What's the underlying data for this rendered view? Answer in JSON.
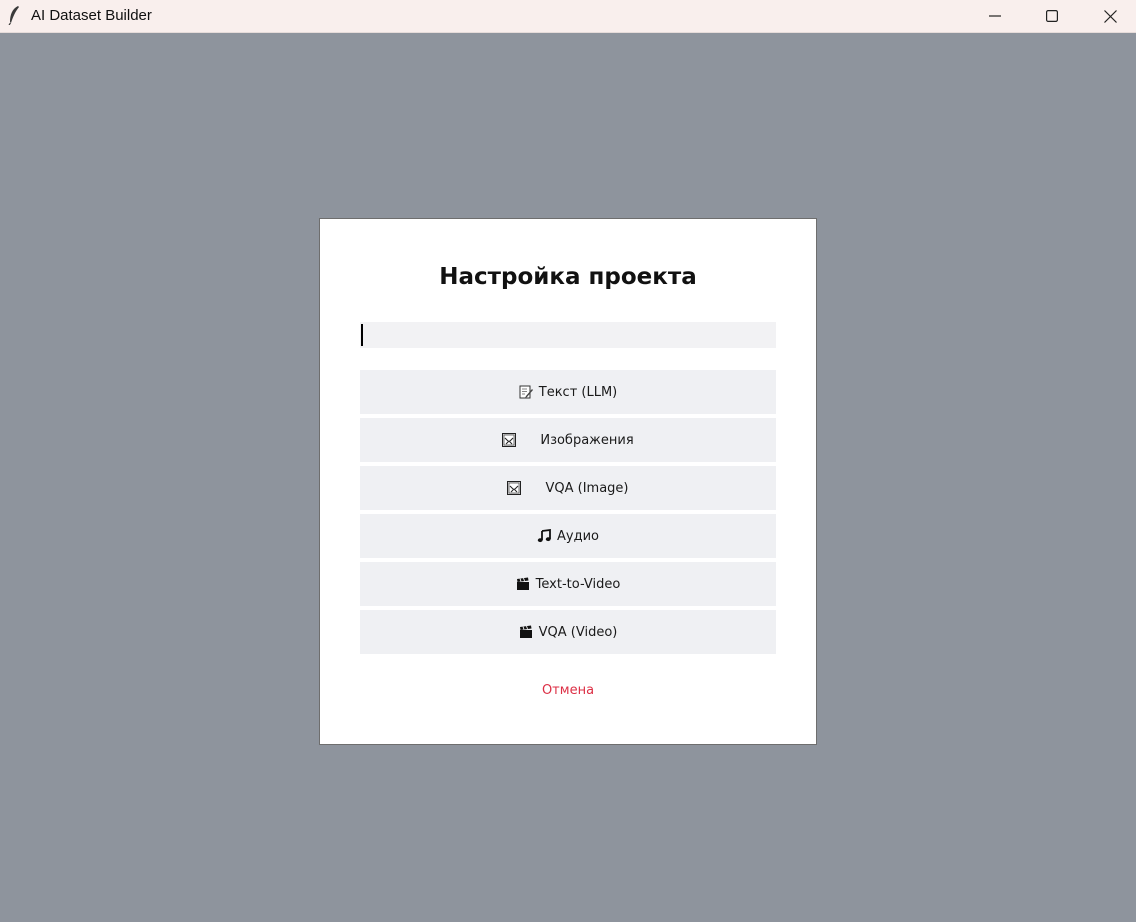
{
  "window": {
    "title": "AI Dataset Builder",
    "app_icon": "feather-icon",
    "controls": [
      "minimize-icon",
      "maximize-icon",
      "close-icon"
    ]
  },
  "dialog": {
    "title": "Настройка проекта",
    "project_name_value": "",
    "options": [
      {
        "icon": "memo-icon",
        "label": "Текст (LLM)"
      },
      {
        "icon": "image-frame-icon",
        "label": "Изображения"
      },
      {
        "icon": "image-frame-icon",
        "label": "VQA (Image)"
      },
      {
        "icon": "music-note-icon",
        "label": "Аудио"
      },
      {
        "icon": "clapper-board-icon",
        "label": "Text-to-Video"
      },
      {
        "icon": "clapper-board-icon",
        "label": "VQA (Video)"
      }
    ],
    "cancel_label": "Отмена"
  },
  "colors": {
    "backdrop": "#8e949d",
    "titlebar": "#f9efed",
    "option_bg": "#eff0f3",
    "cancel": "#dc2f45"
  }
}
